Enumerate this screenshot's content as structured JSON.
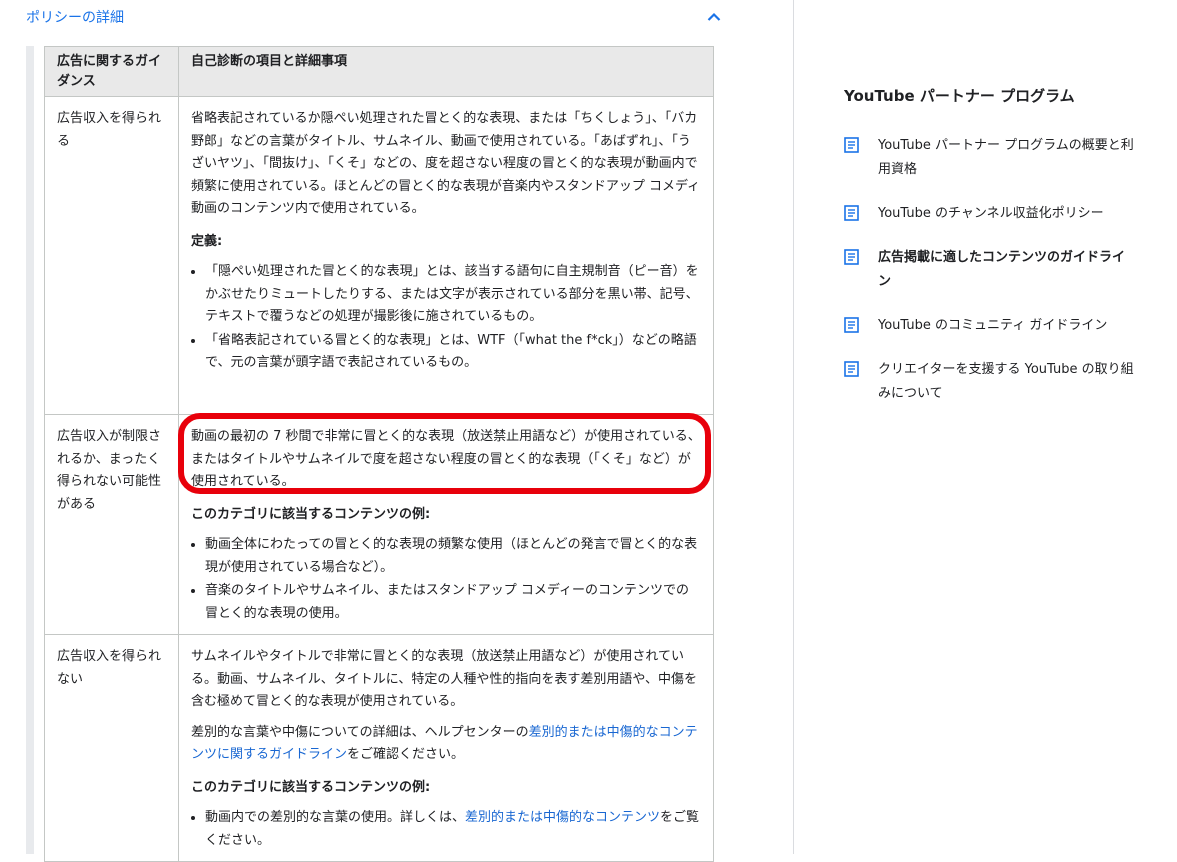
{
  "accordion": {
    "title": "ポリシーの詳細"
  },
  "table": {
    "headers": [
      "広告に関するガイダンス",
      "自己診断の項目と詳細事項"
    ],
    "rows": [
      {
        "guidance": "広告収入を得られる",
        "description": "省略表記されているか隠ぺい処理された冒とく的な表現、または「ちくしょう」、「バカ野郎」などの言葉がタイトル、サムネイル、動画で使用されている。「あばずれ」、「うざいヤツ」、「間抜け」、「くそ」などの、度を超さない程度の冒とく的な表現が動画内で頻繁に使用されている。ほとんどの冒とく的な表現が音楽内やスタンドアップ コメディ動画のコンテンツ内で使用されている。",
        "def_title": "定義:",
        "bullets": [
          "「隠ぺい処理された冒とく的な表現」とは、該当する語句に自主規制音（ピー音）をかぶせたりミュートしたりする、または文字が表示されている部分を黒い帯、記号、テキストで覆うなどの処理が撮影後に施されているもの。",
          "「省略表記されている冒とく的な表現」とは、WTF（「what the f*ck」）などの略語で、元の言葉が頭字語で表記されているもの。"
        ]
      },
      {
        "guidance": "広告収入が制限されるか、まったく得られない可能性がある",
        "description": "動画の最初の 7 秒間で非常に冒とく的な表現（放送禁止用語など）が使用されている、またはタイトルやサムネイルで度を超さない程度の冒とく的な表現（「くそ」など）が使用されている。",
        "examples_title": "このカテゴリに該当するコンテンツの例:",
        "bullets": [
          "動画全体にわたっての冒とく的な表現の頻繁な使用（ほとんどの発言で冒とく的な表現が使用されている場合など）。",
          "音楽のタイトルやサムネイル、またはスタンドアップ コメディーのコンテンツでの冒とく的な表現の使用。"
        ]
      },
      {
        "guidance": "広告収入を得られない",
        "description": "サムネイルやタイトルで非常に冒とく的な表現（放送禁止用語など）が使用されている。動画、サムネイル、タイトルに、特定の人種や性的指向を表す差別用語や、中傷を含む極めて冒とく的な表現が使用されている。",
        "help_prefix": "差別的な言葉や中傷についての詳細は、ヘルプセンターの",
        "help_link": "差別的または中傷的なコンテンツに関するガイドライン",
        "help_suffix": "をご確認ください。",
        "examples_title": "このカテゴリに該当するコンテンツの例:",
        "bullet_prefix": "動画内での差別的な言葉の使用。詳しくは、",
        "bullet_link": "差別的または中傷的なコンテンツ",
        "bullet_suffix": "をご覧ください。"
      }
    ]
  },
  "sidebar": {
    "title": "YouTube パートナー プログラム",
    "items": [
      {
        "label": "YouTube パートナー プログラムの概要と利用資格",
        "icon": "document-icon"
      },
      {
        "label": "YouTube のチャンネル収益化ポリシー",
        "icon": "document-icon"
      },
      {
        "label": "広告掲載に適したコンテンツのガイドライン",
        "icon": "document-icon",
        "active": true
      },
      {
        "label": "YouTube のコミュニティ ガイドライン",
        "icon": "document-icon"
      },
      {
        "label": "クリエイターを支援する YouTube の取り組みについて",
        "icon": "document-icon"
      }
    ]
  },
  "colors": {
    "link": "#1967d2",
    "highlight": "#e8000b",
    "icon": "#1a73e8"
  }
}
